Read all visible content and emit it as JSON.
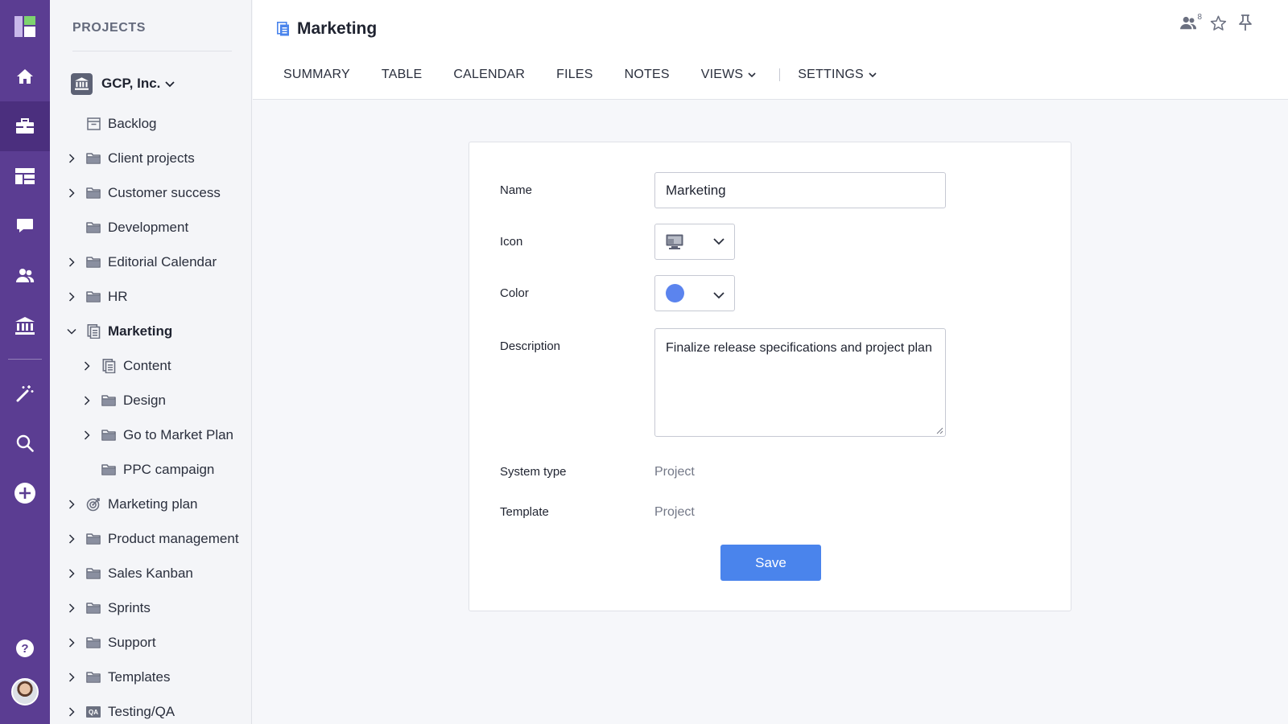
{
  "window": {
    "width": 1600,
    "height": 900
  },
  "colors": {
    "rail": "#5b3d92",
    "rail_active": "#4b2f7e",
    "accent": "#4a84ec",
    "project_color": "#5b84ee"
  },
  "rail": {
    "items": [
      {
        "icon": "app-logo-icon"
      },
      {
        "icon": "home-icon"
      },
      {
        "icon": "briefcase-icon",
        "active": true
      },
      {
        "icon": "dashboard-icon"
      },
      {
        "icon": "chat-icon"
      },
      {
        "icon": "people-icon"
      },
      {
        "icon": "bank-icon"
      },
      {
        "icon": "magic-wand-icon"
      },
      {
        "icon": "search-icon"
      },
      {
        "icon": "add-circle-icon"
      },
      {
        "icon": "help-icon"
      },
      {
        "icon": "avatar"
      }
    ]
  },
  "sidebar": {
    "title": "PROJECTS",
    "org": {
      "name": "GCP, Inc.",
      "icon": "bank-icon"
    },
    "items": [
      {
        "label": "Backlog",
        "icon": "inbox-icon",
        "chevron": "none",
        "level": 0
      },
      {
        "label": "Client projects",
        "icon": "folder-icon",
        "chevron": "right",
        "level": 0
      },
      {
        "label": "Customer success",
        "icon": "folder-icon",
        "chevron": "right",
        "level": 0
      },
      {
        "label": "Development",
        "icon": "folder-icon",
        "chevron": "none",
        "level": 0
      },
      {
        "label": "Editorial Calendar",
        "icon": "folder-icon",
        "chevron": "right",
        "level": 0
      },
      {
        "label": "HR",
        "icon": "folder-icon",
        "chevron": "right",
        "level": 0
      },
      {
        "label": "Marketing",
        "icon": "project-icon",
        "chevron": "down",
        "level": 0,
        "selected": true
      },
      {
        "label": "Content",
        "icon": "project-icon",
        "chevron": "right",
        "level": 1
      },
      {
        "label": "Design",
        "icon": "folder-icon",
        "chevron": "right",
        "level": 1
      },
      {
        "label": "Go to Market Plan",
        "icon": "folder-icon",
        "chevron": "right",
        "level": 1
      },
      {
        "label": "PPC campaign",
        "icon": "folder-icon",
        "chevron": "none",
        "level": 1
      },
      {
        "label": "Marketing plan",
        "icon": "target-icon",
        "chevron": "right",
        "level": 0
      },
      {
        "label": "Product management",
        "icon": "folder-icon",
        "chevron": "right",
        "level": 0
      },
      {
        "label": "Sales Kanban",
        "icon": "folder-icon",
        "chevron": "right",
        "level": 0
      },
      {
        "label": "Sprints",
        "icon": "folder-icon",
        "chevron": "right",
        "level": 0
      },
      {
        "label": "Support",
        "icon": "folder-icon",
        "chevron": "right",
        "level": 0
      },
      {
        "label": "Templates",
        "icon": "folder-icon",
        "chevron": "right",
        "level": 0
      },
      {
        "label": "Testing/QA",
        "icon": "qa-icon",
        "chevron": "right",
        "level": 0
      }
    ]
  },
  "header": {
    "title": "Marketing",
    "title_icon": "project-icon",
    "tabs": [
      {
        "label": "SUMMARY"
      },
      {
        "label": "TABLE"
      },
      {
        "label": "CALENDAR"
      },
      {
        "label": "FILES"
      },
      {
        "label": "NOTES"
      },
      {
        "label": "VIEWS",
        "dropdown": true
      },
      {
        "label": "SETTINGS",
        "dropdown": true
      }
    ],
    "members_count": "8",
    "icons": [
      "members-icon",
      "star-icon",
      "pin-icon"
    ]
  },
  "form": {
    "name_label": "Name",
    "name_value": "Marketing",
    "icon_label": "Icon",
    "icon_value": "monitor-icon",
    "color_label": "Color",
    "description_label": "Description",
    "description_value": "Finalize release specifications and project plan",
    "system_type_label": "System type",
    "system_type_value": "Project",
    "template_label": "Template",
    "template_value": "Project",
    "save_label": "Save"
  }
}
